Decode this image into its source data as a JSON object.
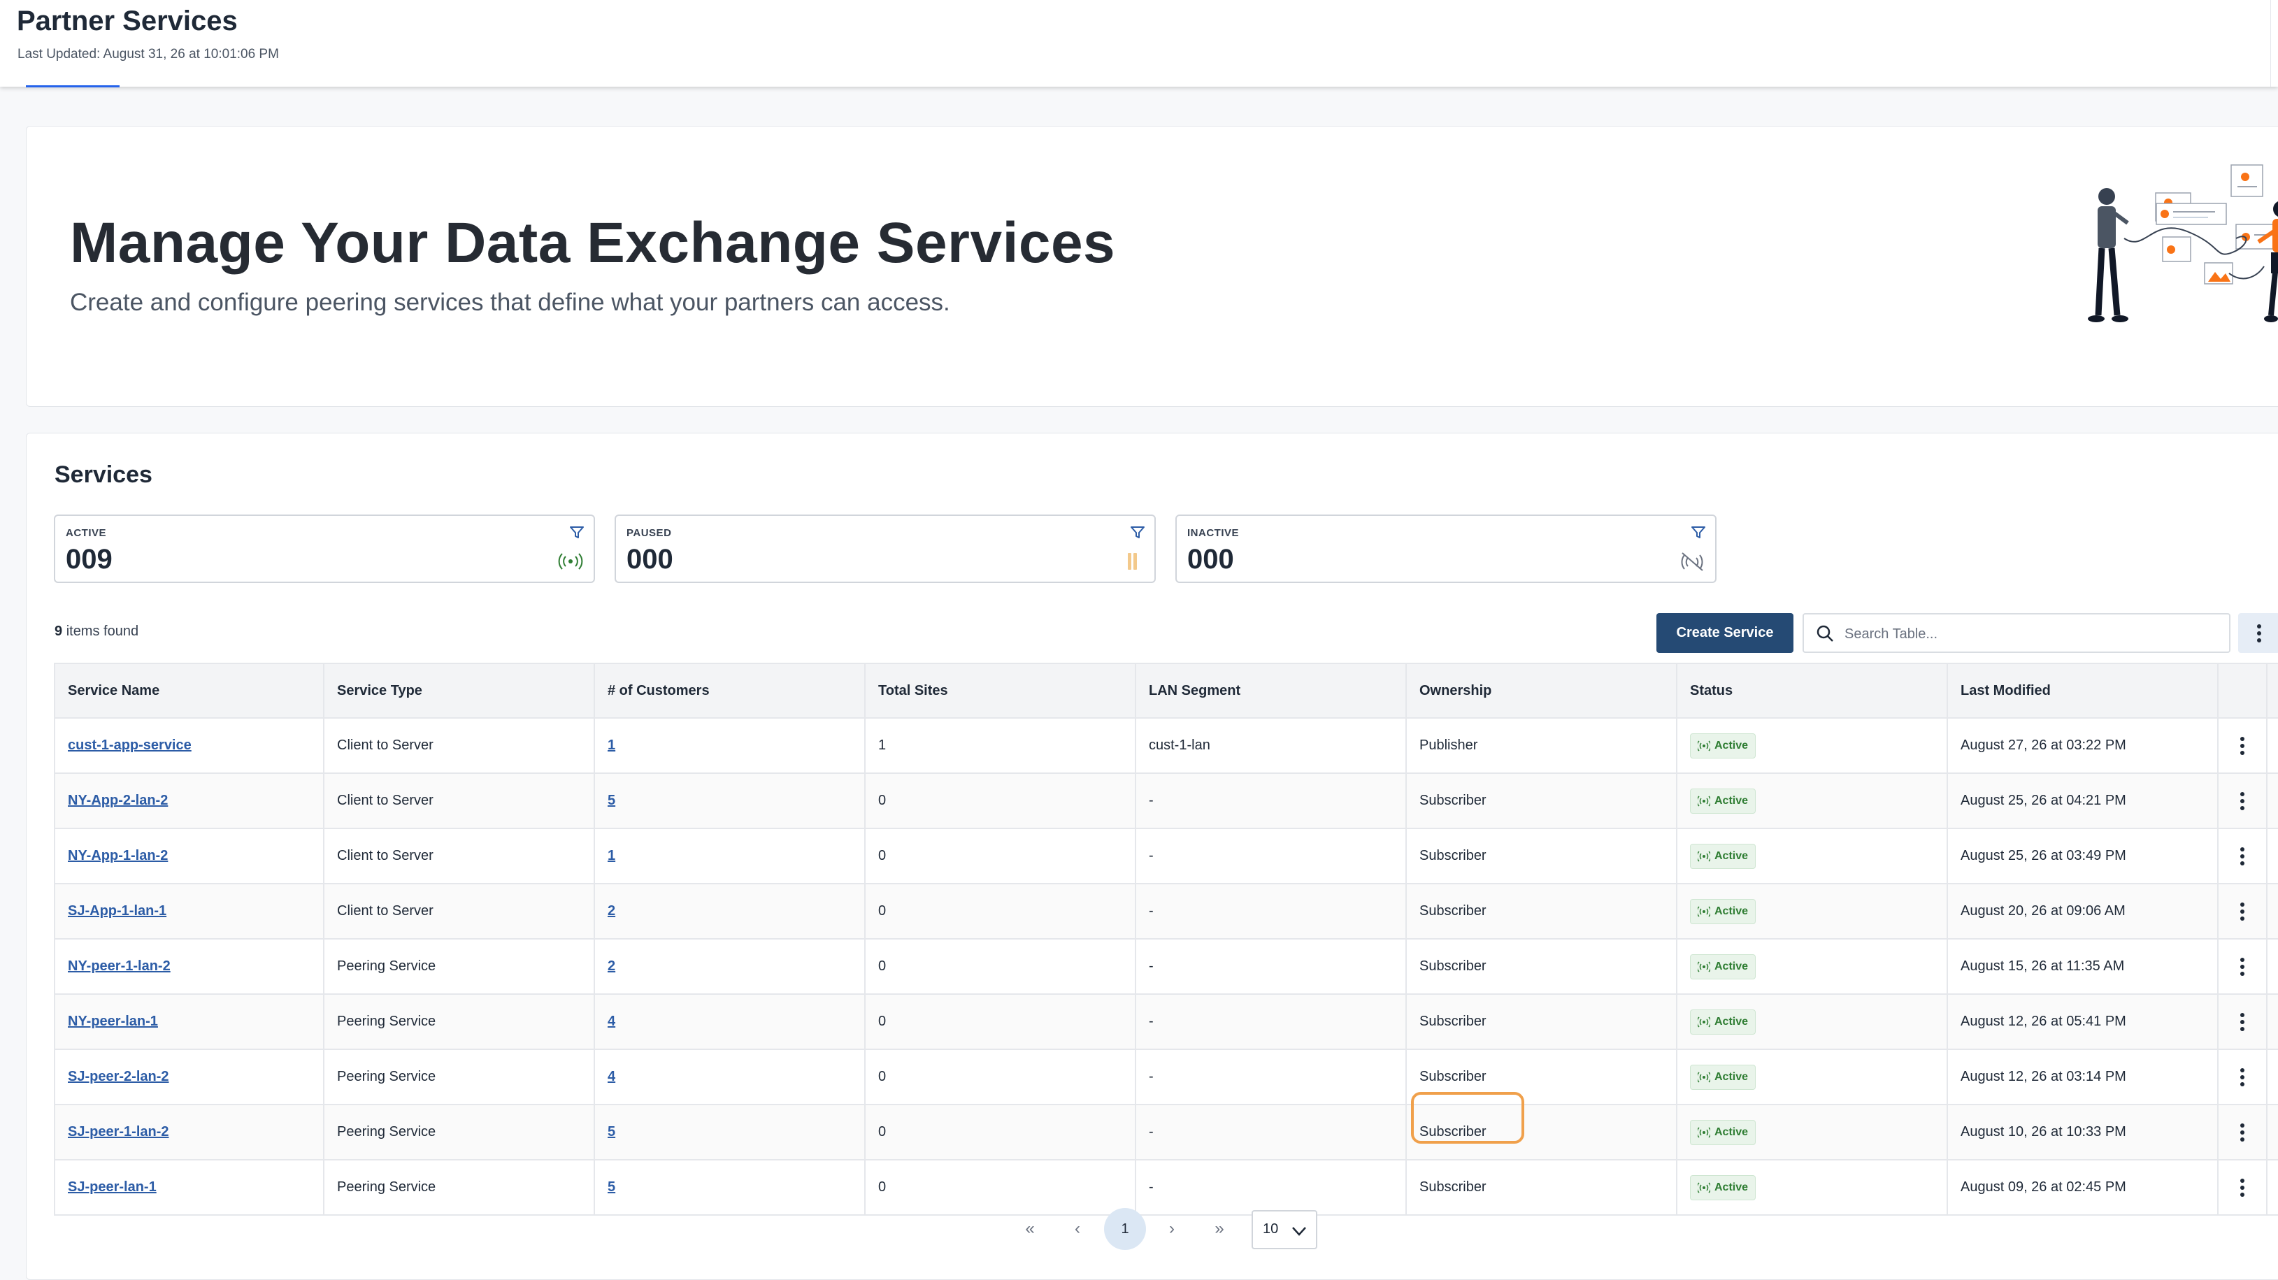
{
  "header": {
    "title": "Partner Services",
    "last_updated": "Last Updated: August 31, 26 at 10:01:06 PM"
  },
  "hero": {
    "headline": "Manage Your Data Exchange Services",
    "subline": "Create and configure peering services that define what your partners can access.",
    "illustration": "people-connecting-data-illustration"
  },
  "services": {
    "heading": "Services",
    "stats": [
      {
        "label": "ACTIVE",
        "value": "009",
        "icon": "broadcast-icon",
        "color": "#2e7d32"
      },
      {
        "label": "PAUSED",
        "value": "000",
        "icon": "pause-icon",
        "color": "#f3c98b"
      },
      {
        "label": "INACTIVE",
        "value": "000",
        "icon": "signal-off-icon",
        "color": "#6b7280"
      }
    ],
    "found_count": "9",
    "found_text": "items found",
    "create_button": "Create Service",
    "search_placeholder": "Search Table..."
  },
  "table": {
    "columns": [
      "Service Name",
      "Service Type",
      "# of Customers",
      "Total Sites",
      "LAN Segment",
      "Ownership",
      "Status",
      "Last Modified"
    ],
    "rows": [
      {
        "name": "cust-1-app-service",
        "type": "Client to Server",
        "customers": "1",
        "sites": "1",
        "lan": "cust-1-lan",
        "ownership": "Publisher",
        "status": "Active",
        "modified": "August 27, 26 at 03:22 PM"
      },
      {
        "name": "NY-App-2-lan-2",
        "type": "Client to Server",
        "customers": "5",
        "sites": "0",
        "lan": "-",
        "ownership": "Subscriber",
        "status": "Active",
        "modified": "August 25, 26 at 04:21 PM"
      },
      {
        "name": "NY-App-1-lan-2",
        "type": "Client to Server",
        "customers": "1",
        "sites": "0",
        "lan": "-",
        "ownership": "Subscriber",
        "status": "Active",
        "modified": "August 25, 26 at 03:49 PM"
      },
      {
        "name": "SJ-App-1-lan-1",
        "type": "Client to Server",
        "customers": "2",
        "sites": "0",
        "lan": "-",
        "ownership": "Subscriber",
        "status": "Active",
        "modified": "August 20, 26 at 09:06 AM"
      },
      {
        "name": "NY-peer-1-lan-2",
        "type": "Peering Service",
        "customers": "2",
        "sites": "0",
        "lan": "-",
        "ownership": "Subscriber",
        "status": "Active",
        "modified": "August 15, 26 at 11:35 AM"
      },
      {
        "name": "NY-peer-lan-1",
        "type": "Peering Service",
        "customers": "4",
        "sites": "0",
        "lan": "-",
        "ownership": "Subscriber",
        "status": "Active",
        "modified": "August 12, 26 at 05:41 PM"
      },
      {
        "name": "SJ-peer-2-lan-2",
        "type": "Peering Service",
        "customers": "4",
        "sites": "0",
        "lan": "-",
        "ownership": "Subscriber",
        "status": "Active",
        "modified": "August 12, 26 at 03:14 PM"
      },
      {
        "name": "SJ-peer-1-lan-2",
        "type": "Peering Service",
        "customers": "5",
        "sites": "0",
        "lan": "-",
        "ownership": "Subscriber",
        "status": "Active",
        "modified": "August 10, 26 at 10:33 PM"
      },
      {
        "name": "SJ-peer-lan-1",
        "type": "Peering Service",
        "customers": "5",
        "sites": "0",
        "lan": "-",
        "ownership": "Subscriber",
        "status": "Active",
        "modified": "August 09, 26 at 02:45 PM"
      }
    ]
  },
  "pagination": {
    "first": "«",
    "prev": "‹",
    "current_page": "1",
    "next": "›",
    "last": "»",
    "per_page": "10"
  },
  "colors": {
    "accent": "#254a74",
    "link": "#2c5ca6",
    "active_badge": "#2e7d32",
    "highlight": "#f0a04b"
  }
}
